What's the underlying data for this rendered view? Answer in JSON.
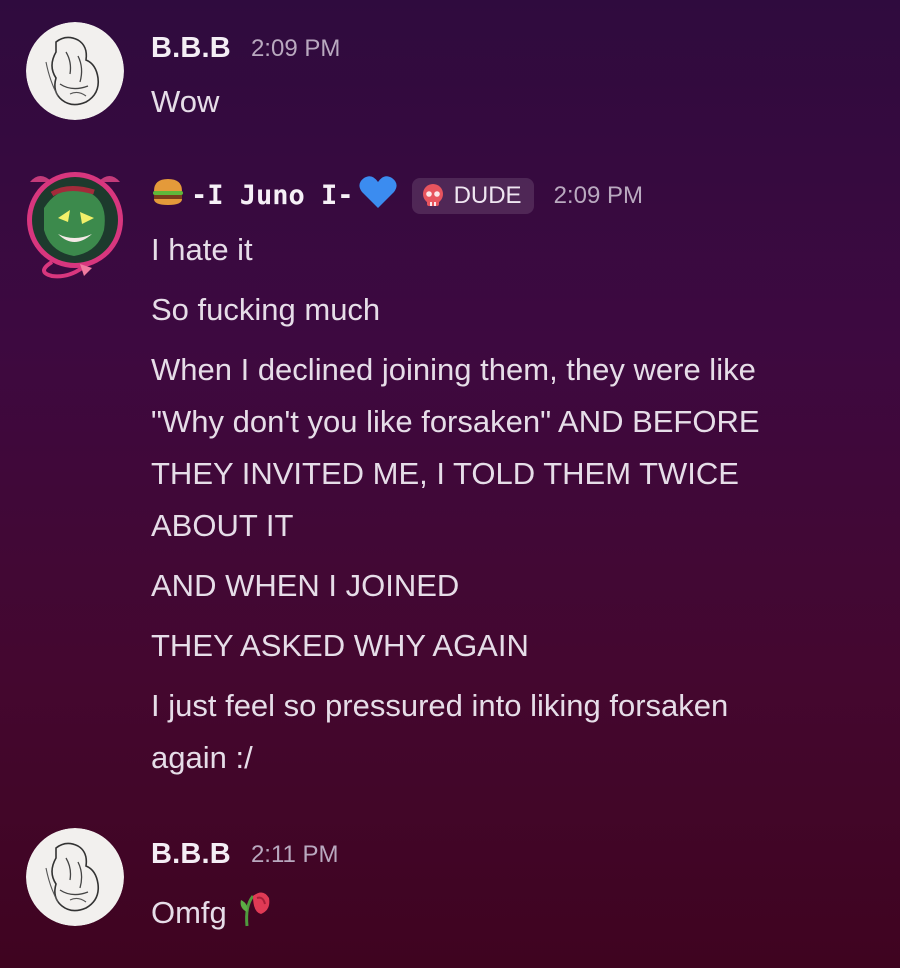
{
  "messages": [
    {
      "author": "B.B.B",
      "time": "2:09 PM",
      "avatar_icon": "sketch-avatar",
      "lines": [
        "Wow"
      ]
    },
    {
      "author_prefix_emoji": "hamburger-emoji",
      "author": "-I Juno I-",
      "author_suffix_emoji": "blue-heart-emoji",
      "role_badge": "DUDE",
      "role_badge_icon": "skull-icon",
      "time": "2:09 PM",
      "avatar_icon": "green-monster-avatar",
      "lines": [
        "I hate it",
        "So fucking much",
        "When I declined joining them, they were like",
        "\"Why don't you like forsaken\" AND BEFORE",
        "THEY INVITED ME, I TOLD THEM TWICE",
        "ABOUT IT",
        "AND WHEN I JOINED",
        "THEY ASKED WHY AGAIN",
        "I just feel so pressured into liking forsaken",
        "again :/"
      ]
    },
    {
      "author": "B.B.B",
      "time": "2:11 PM",
      "avatar_icon": "sketch-avatar",
      "lines": [
        "Omfg"
      ],
      "trailing_emoji": "wilted-flower-emoji"
    }
  ],
  "colors": {
    "background_top": "#2f0b3e",
    "background_bottom": "#3f0420",
    "username": "#f4eef5",
    "timestamp": "#b9a9bf",
    "message_text": "#e6dde8",
    "heart": "#3b8cf0"
  }
}
